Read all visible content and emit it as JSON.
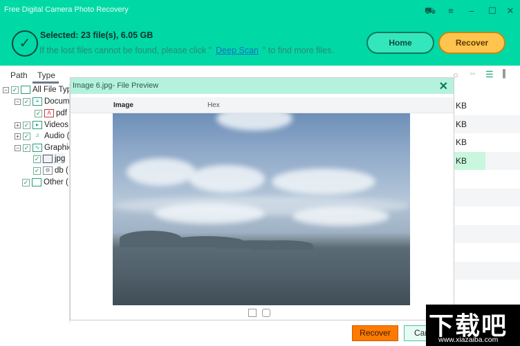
{
  "app": {
    "title": "Free Digital Camera Photo Recovery",
    "window_controls": [
      "cart-icon",
      "menu-icon",
      "minimize-icon",
      "maximize-icon",
      "close-icon"
    ]
  },
  "header": {
    "selected": "Selected: 23 file(s), 6.05 GB",
    "hint_before": "If the lost files cannot be found, please click \"",
    "deep_scan": "Deep Scan",
    "hint_after": "\" to find more files.",
    "home": "Home",
    "recover": "Recover",
    "accent": "#00d8a6"
  },
  "tabs": {
    "path": "Path",
    "type": "Type"
  },
  "tree": [
    {
      "label": "All File Typ",
      "icon": "monitor-icon"
    },
    {
      "label": "Docum",
      "icon": "document-icon"
    },
    {
      "label": "pdf",
      "icon": "pdf-icon"
    },
    {
      "label": "Videos",
      "icon": "video-icon"
    },
    {
      "label": "Audio (",
      "icon": "audio-icon"
    },
    {
      "label": "Graphic",
      "icon": "graphics-icon"
    },
    {
      "label": "jpg",
      "icon": "image-icon"
    },
    {
      "label": "db (",
      "icon": "db-icon"
    },
    {
      "label": "Other (",
      "icon": "folder-icon"
    }
  ],
  "list": {
    "rows": [
      "KB",
      "KB",
      "KB",
      "KB"
    ]
  },
  "dialog": {
    "title": "Image 6.jpg- File Preview",
    "col_image": "Image",
    "col_hex": "Hex",
    "recover": "Recover",
    "cancel": "Cancel"
  },
  "watermark": {
    "logo": "下载吧",
    "url": "www.xiazaiba.com"
  }
}
